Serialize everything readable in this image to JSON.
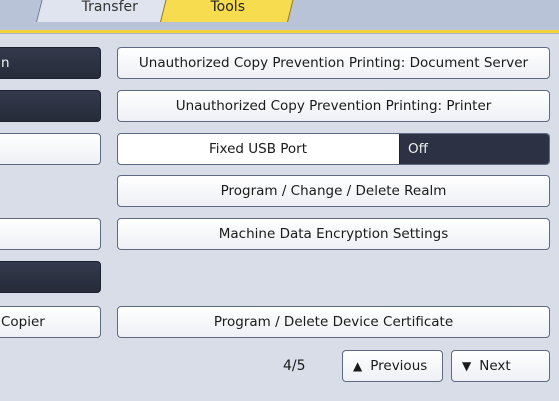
{
  "tabs": [
    {
      "label": "Transfer"
    },
    {
      "label": "Tools"
    }
  ],
  "left_buttons": [
    {
      "label": "n"
    },
    {
      "label": ""
    },
    {
      "label": ""
    },
    {
      "label": ""
    },
    {
      "label": ""
    },
    {
      "label": "Copier"
    }
  ],
  "main_buttons": {
    "copy_prevention_doc_server": "Unauthorized Copy Prevention Printing: Document Server",
    "copy_prevention_printer": "Unauthorized Copy Prevention Printing: Printer",
    "program_realm": "Program / Change / Delete Realm",
    "encryption": "Machine Data Encryption Settings",
    "device_certificate": "Program / Delete Device Certificate"
  },
  "fixed_usb": {
    "label": "Fixed USB Port",
    "value": "Off"
  },
  "pagination": {
    "indicator": "4/5",
    "previous_label": "Previous",
    "next_label": "Next",
    "previous_icon": "up-triangle-icon",
    "next_icon": "down-triangle-icon"
  },
  "colors": {
    "active_tab": "#f6dc4e",
    "selected": "#2c3243"
  }
}
